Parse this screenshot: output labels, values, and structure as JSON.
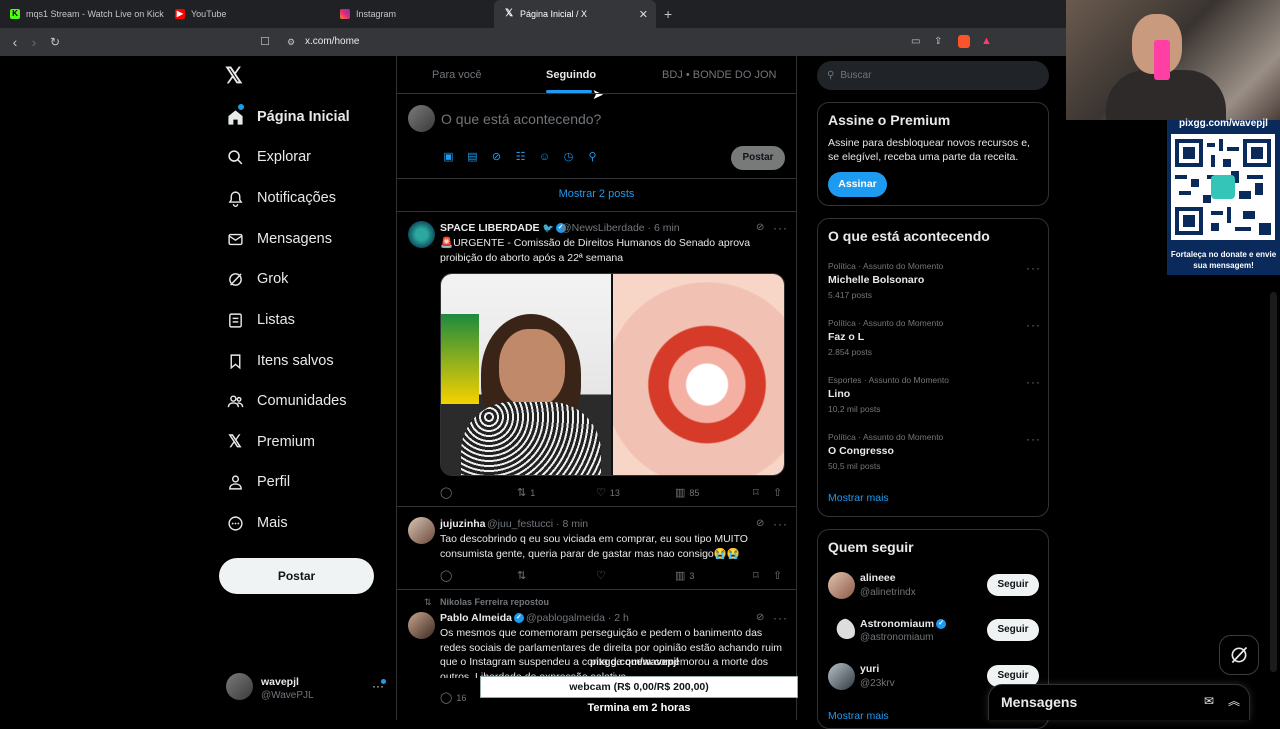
{
  "browser": {
    "tabs": [
      {
        "label": "mqs1 Stream - Watch Live on Kick",
        "icon": "kick-icon"
      },
      {
        "label": "YouTube",
        "icon": "youtube-icon"
      },
      {
        "label": "Instagram",
        "icon": "instagram-icon"
      },
      {
        "label": "Página Inicial / X",
        "icon": "x-icon",
        "active": true
      }
    ],
    "url": "x.com/home"
  },
  "stream_overlay": {
    "pix_url": "pixgg.com/wavepjl",
    "pix_message": "Fortaleça no donate e envie sua mensagem!",
    "ticker_url": "pixgg.com/wavepjl",
    "webcam_goal": "webcam (R$ 0,00/R$ 200,00)",
    "ends_in": "Termina em 2 horas"
  },
  "nav": {
    "items": [
      {
        "label": "Página Inicial",
        "icon": "home-icon"
      },
      {
        "label": "Explorar",
        "icon": "search-icon"
      },
      {
        "label": "Notificações",
        "icon": "bell-icon"
      },
      {
        "label": "Mensagens",
        "icon": "envelope-icon"
      },
      {
        "label": "Grok",
        "icon": "grok-icon"
      },
      {
        "label": "Listas",
        "icon": "list-icon"
      },
      {
        "label": "Itens salvos",
        "icon": "bookmark-icon"
      },
      {
        "label": "Comunidades",
        "icon": "people-icon"
      },
      {
        "label": "Premium",
        "icon": "x-icon"
      },
      {
        "label": "Perfil",
        "icon": "person-icon"
      },
      {
        "label": "Mais",
        "icon": "more-circle-icon"
      }
    ],
    "post_button": "Postar",
    "account": {
      "name": "wavepjl",
      "handle": "@WavePJL"
    }
  },
  "timeline": {
    "tabs": [
      "Para você",
      "Seguindo",
      "BDJ • BONDE DO JON"
    ],
    "active_tab": "Seguindo",
    "compose_placeholder": "O que está acontecendo?",
    "compose_post": "Postar",
    "show_posts": "Mostrar 2 posts",
    "posts": [
      {
        "name": "SPACE LIBERDADE",
        "handle": "@NewsLiberdade · 6 min",
        "text": "🚨URGENTE - Comissão de Direitos Humanos do Senado aprova proibição do aborto após a 22ª semana",
        "replies": "",
        "reposts": "1",
        "likes": "13",
        "views": "85"
      },
      {
        "name": "jujuzinha",
        "handle": "@juu_festucci · 8 min",
        "text": "Tao descobrindo q eu sou viciada em comprar, eu sou tipo MUITO consumista gente, queria parar de gastar mas nao consigo😭😭",
        "replies": "",
        "reposts": "",
        "likes": "",
        "views": "3"
      },
      {
        "repost_by": "Nikolas Ferreira repostou",
        "name": "Pablo Almeida",
        "handle": "@pablogalmeida · 2 h",
        "text": "Os mesmos que comemoram perseguição e pedem o banimento das redes sociais de parlamentares de direita por opinião estão achando ruim que o Instagram suspendeu a conta de quem comemorou a morte dos outros. Liberdade de expressão seletiva.",
        "replies": "16"
      }
    ]
  },
  "sidebar": {
    "search_placeholder": "Buscar",
    "premium": {
      "title": "Assine o Premium",
      "text": "Assine para desbloquear novos recursos e, se elegível, receba uma parte da receita.",
      "button": "Assinar"
    },
    "trends": {
      "title": "O que está acontecendo",
      "items": [
        {
          "meta": "Política · Assunto do Momento",
          "name": "Michelle Bolsonaro",
          "count": "5.417 posts"
        },
        {
          "meta": "Política · Assunto do Momento",
          "name": "Faz o L",
          "count": "2.854 posts"
        },
        {
          "meta": "Esportes · Assunto do Momento",
          "name": "Lino",
          "count": "10,2 mil posts"
        },
        {
          "meta": "Política · Assunto do Momento",
          "name": "O Congresso",
          "count": "50,5 mil posts"
        }
      ],
      "show_more": "Mostrar mais"
    },
    "who_to_follow": {
      "title": "Quem seguir",
      "items": [
        {
          "name": "alineee",
          "handle": "@alinetrindx",
          "button": "Seguir"
        },
        {
          "name": "Astronomiaum",
          "handle": "@astronomiaum",
          "button": "Seguir",
          "verified": true
        },
        {
          "name": "yuri",
          "handle": "@23krv",
          "button": "Seguir"
        }
      ],
      "show_more": "Mostrar mais"
    },
    "messages_drawer": "Mensagens"
  },
  "colors": {
    "accent": "#1d9bf0",
    "background": "#000000",
    "border": "#2f3336",
    "muted": "#71767b"
  }
}
